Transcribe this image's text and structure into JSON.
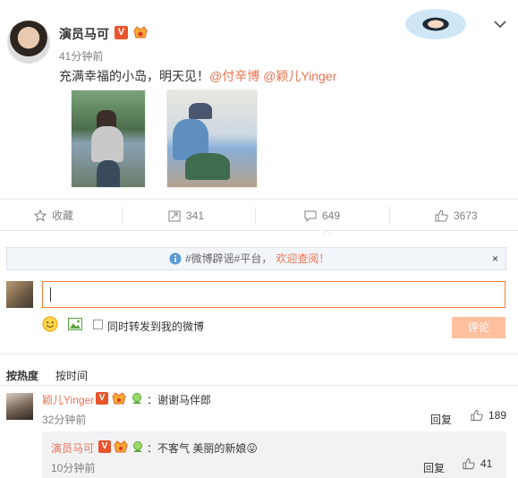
{
  "post": {
    "author": "演员马可",
    "time": "41分钟前",
    "text_prefix": "充满幸福的小岛，明天见！",
    "mention1": "@付辛博",
    "mention2": "@颖儿Yinger",
    "verified_badge": "V"
  },
  "actions": {
    "favorite": "收藏",
    "repost": "341",
    "comment": "649",
    "like": "3673"
  },
  "notice": {
    "prefix": "#微博辟谣#平台，",
    "link": "欢迎查阅！",
    "close": "×"
  },
  "composer": {
    "repost_label": "同时转发到我的微博",
    "submit": "评论"
  },
  "sort": {
    "hot": "按热度",
    "time": "按时间"
  },
  "comment": {
    "author": "颖儿Yinger",
    "verified_badge": "V",
    "text": "：谢谢马伴郎",
    "time": "32分钟前",
    "reply_label": "回复",
    "likes": "189"
  },
  "reply": {
    "author": "演员马可",
    "verified_badge": "V",
    "text": "：不客气 美丽的新娘",
    "emoji": "😛",
    "time": "10分钟前",
    "reply_label": "回复",
    "likes": "41"
  },
  "colors": {
    "accent": "#eb7350",
    "input_border": "#fa7d3c",
    "submit_disabled": "#ffc09f"
  }
}
